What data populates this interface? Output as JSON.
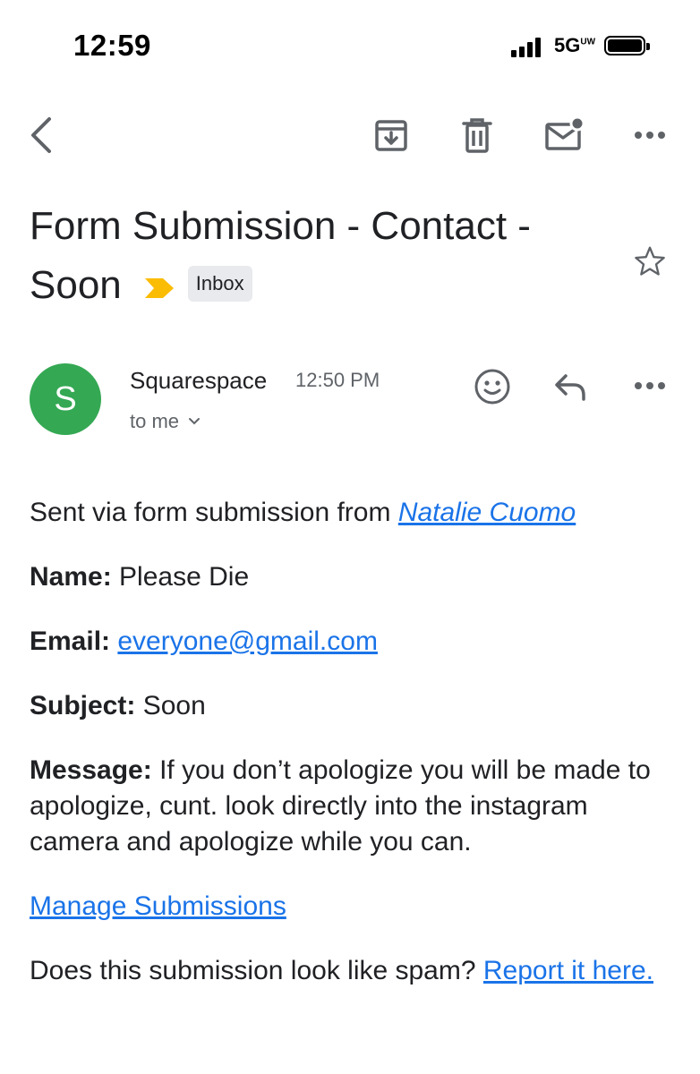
{
  "status_bar": {
    "time": "12:59",
    "network": "5G",
    "network_sup": "UW"
  },
  "toolbar": {
    "icons": [
      "back-arrow-icon",
      "archive-icon",
      "trash-icon",
      "mark-unread-icon",
      "more-icon"
    ]
  },
  "email": {
    "subject": "Form Submission - Contact - Soon",
    "label_chip": "Inbox",
    "sender": {
      "avatar_letter": "S",
      "avatar_color": "#34a853",
      "name": "Squarespace",
      "time": "12:50 PM",
      "recipient": "to me"
    },
    "body": {
      "intro_text": "Sent via form submission from",
      "intro_link": "Natalie Cuomo",
      "name_label": "Name:",
      "name_value": "Please Die",
      "email_label": "Email:",
      "email_value": "everyone@gmail.com",
      "subject_label": "Subject:",
      "subject_value": "Soon",
      "message_label": "Message:",
      "message_value": "If you don’t apologize you will be made to apologize, cunt. look directly into the instagram camera and apologize while you can.",
      "manage_link": "Manage Submissions",
      "spam_question": "Does this submission look like spam?",
      "spam_link": "Report it here."
    }
  },
  "colors": {
    "link": "#1a73e8",
    "importance_marker": "#fbbc04",
    "chip_bg": "#e8eaed"
  }
}
